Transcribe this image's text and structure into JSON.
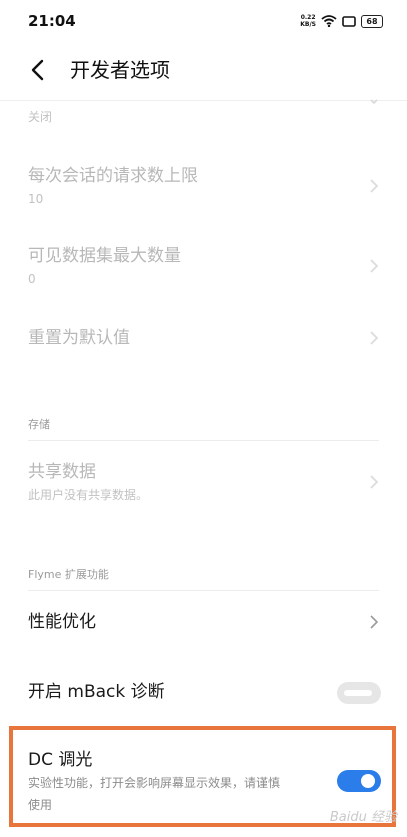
{
  "status_bar": {
    "time": "21:04",
    "net_speed_value": "0.22",
    "net_speed_unit": "KB/S",
    "battery": "68"
  },
  "top_bar": {
    "title": "开发者选项"
  },
  "items": {
    "partial_top": {
      "subtitle": "关闭"
    },
    "request_limit": {
      "title": "每次会话的请求数上限",
      "subtitle": "10"
    },
    "max_datasets": {
      "title": "可见数据集最大数量",
      "subtitle": "0"
    },
    "reset_defaults": {
      "title": "重置为默认值"
    },
    "shared_data": {
      "title": "共享数据",
      "subtitle": "此用户没有共享数据。"
    },
    "performance": {
      "title": "性能优化"
    },
    "mback": {
      "title": "开启 mBack 诊断",
      "enabled": false
    },
    "dc_dimming": {
      "title": "DC 调光",
      "subtitle": "实验性功能，打开会影响屏幕显示效果，请谨慎使用",
      "enabled": true
    }
  },
  "sections": {
    "storage": "存储",
    "flyme": "Flyme 扩展功能"
  },
  "watermark": "Baidu 经验",
  "colors": {
    "accent": "#2b7de9",
    "toggle_off": "#e6e6e6",
    "highlight": "#e8763c",
    "disabled_text": "#b8b8b8"
  }
}
